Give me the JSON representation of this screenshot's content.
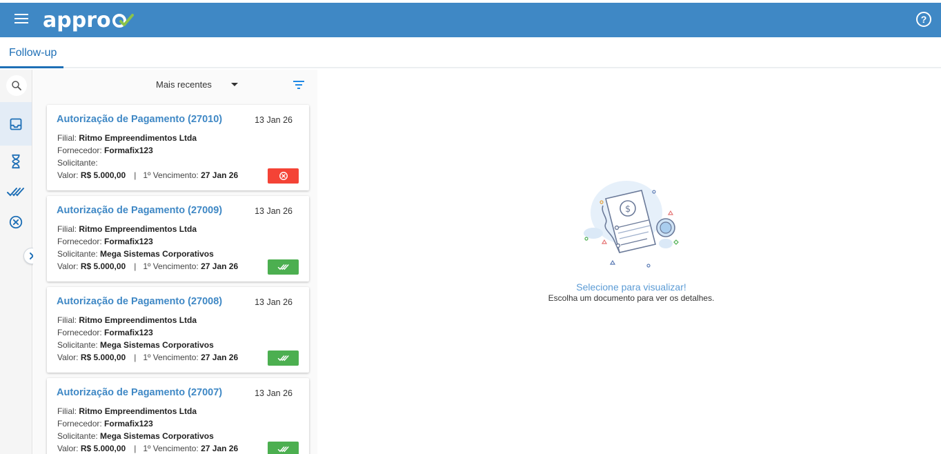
{
  "app": {
    "logo_text": "appro",
    "help_label": "?"
  },
  "tabs": [
    {
      "label": "Follow-up"
    }
  ],
  "list": {
    "sort_label": "Mais recentes"
  },
  "cards": [
    {
      "title": "Autorização de Pagamento (27010)",
      "date": "13 Jan 26",
      "filial_label": "Filial:",
      "filial": "Ritmo Empreendimentos Ltda",
      "fornecedor_label": "Fornecedor:",
      "fornecedor": "Formafix123",
      "solicitante_label": "Solicitante:",
      "solicitante": "",
      "valor_label": "Valor:",
      "valor": "R$ 5.000,00",
      "separator": "|",
      "vencimento_label": "1º Vencimento:",
      "vencimento": "27 Jan 26",
      "status": "rejected"
    },
    {
      "title": "Autorização de Pagamento (27009)",
      "date": "13 Jan 26",
      "filial_label": "Filial:",
      "filial": "Ritmo Empreendimentos Ltda",
      "fornecedor_label": "Fornecedor:",
      "fornecedor": "Formafix123",
      "solicitante_label": "Solicitante:",
      "solicitante": "Mega Sistemas Corporativos",
      "valor_label": "Valor:",
      "valor": "R$ 5.000,00",
      "separator": "|",
      "vencimento_label": "1º Vencimento:",
      "vencimento": "27 Jan 26",
      "status": "approved"
    },
    {
      "title": "Autorização de Pagamento (27008)",
      "date": "13 Jan 26",
      "filial_label": "Filial:",
      "filial": "Ritmo Empreendimentos Ltda",
      "fornecedor_label": "Fornecedor:",
      "fornecedor": "Formafix123",
      "solicitante_label": "Solicitante:",
      "solicitante": "Mega Sistemas Corporativos",
      "valor_label": "Valor:",
      "valor": "R$ 5.000,00",
      "separator": "|",
      "vencimento_label": "1º Vencimento:",
      "vencimento": "27 Jan 26",
      "status": "approved"
    },
    {
      "title": "Autorização de Pagamento (27007)",
      "date": "13 Jan 26",
      "filial_label": "Filial:",
      "filial": "Ritmo Empreendimentos Ltda",
      "fornecedor_label": "Fornecedor:",
      "fornecedor": "Formafix123",
      "solicitante_label": "Solicitante:",
      "solicitante": "Mega Sistemas Corporativos",
      "valor_label": "Valor:",
      "valor": "R$ 5.000,00",
      "separator": "|",
      "vencimento_label": "1º Vencimento:",
      "vencimento": "27 Jan 26",
      "status": "approved"
    }
  ],
  "empty_state": {
    "title": "Selecione para visualizar!",
    "subtitle": "Escolha um documento para ver os detalhes."
  },
  "colors": {
    "brand": "#3f88c5",
    "rejected": "#f44336",
    "approved": "#4caf50"
  },
  "icons": [
    "menu-icon",
    "help-icon",
    "search-icon",
    "inbox-icon",
    "hourglass-icon",
    "double-check-icon",
    "cancel-circle-icon",
    "chevron-right-icon",
    "filter-icon",
    "document-illustration"
  ]
}
